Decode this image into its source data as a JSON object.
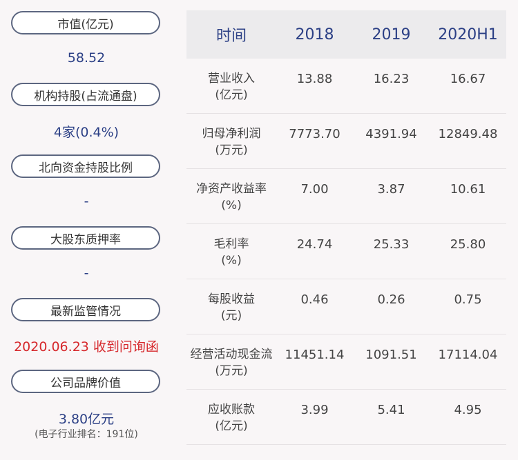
{
  "left_panel": {
    "items": [
      {
        "label": "市值(亿元)",
        "value": "58.52"
      },
      {
        "label": "机构持股(占流通盘)",
        "value": "4家(0.4%)"
      },
      {
        "label": "北向资金持股比例",
        "value": "-"
      },
      {
        "label": "大股东质押率",
        "value": "-"
      },
      {
        "label": "最新监管情况",
        "value": "2020.06.23 收到问询函"
      },
      {
        "label": "公司品牌价值",
        "value": "3.80亿元",
        "note": "(电子行业排名：191位)"
      }
    ]
  },
  "table": {
    "headers": [
      "时间",
      "2018",
      "2019",
      "2020H1"
    ],
    "rows": [
      {
        "label_line1": "营业收入",
        "label_line2": "(亿元)",
        "values": [
          "13.88",
          "16.23",
          "16.67"
        ]
      },
      {
        "label_line1": "归母净利润",
        "label_line2": "(万元)",
        "values": [
          "7773.70",
          "4391.94",
          "12849.48"
        ]
      },
      {
        "label_line1": "净资产收益率",
        "label_line2": "(%)",
        "values": [
          "7.00",
          "3.87",
          "10.61"
        ]
      },
      {
        "label_line1": "毛利率",
        "label_line2": "(%)",
        "values": [
          "24.74",
          "25.33",
          "25.80"
        ]
      },
      {
        "label_line1": "每股收益",
        "label_line2": "(元)",
        "values": [
          "0.46",
          "0.26",
          "0.75"
        ]
      },
      {
        "label_line1": "经营活动现金流",
        "label_line2": "(万元)",
        "values": [
          "11451.14",
          "1091.51",
          "17114.04"
        ]
      },
      {
        "label_line1": "应收账款",
        "label_line2": "(亿元)",
        "values": [
          "3.99",
          "5.41",
          "4.95"
        ]
      }
    ]
  }
}
